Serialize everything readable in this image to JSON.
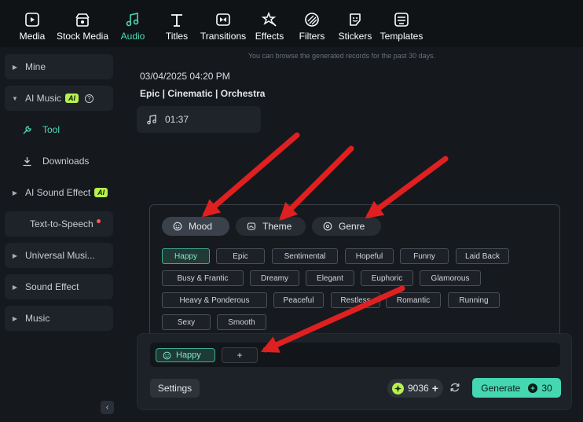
{
  "toolbar": {
    "items": [
      {
        "label": "Media",
        "icon": "media-icon"
      },
      {
        "label": "Stock Media",
        "icon": "stock-media-icon"
      },
      {
        "label": "Audio",
        "icon": "audio-icon",
        "active": true
      },
      {
        "label": "Titles",
        "icon": "titles-icon"
      },
      {
        "label": "Transitions",
        "icon": "transitions-icon"
      },
      {
        "label": "Effects",
        "icon": "effects-icon"
      },
      {
        "label": "Filters",
        "icon": "filters-icon"
      },
      {
        "label": "Stickers",
        "icon": "stickers-icon"
      },
      {
        "label": "Templates",
        "icon": "templates-icon"
      }
    ]
  },
  "sidebar": {
    "mine": "Mine",
    "ai_music": "AI Music",
    "ai_badge": "AI",
    "tool": "Tool",
    "downloads": "Downloads",
    "ai_sound_effect": "AI Sound Effect",
    "text_to_speech": "Text-to-Speech",
    "universal_music": "Universal Musi...",
    "sound_effect": "Sound Effect",
    "music": "Music",
    "collapse_glyph": "‹"
  },
  "main": {
    "note": "You can browse the generated records for the past 30 days.",
    "record": {
      "date": "03/04/2025 04:20 PM",
      "tags": "Epic | Cinematic | Orchestra",
      "duration": "01:37"
    },
    "categories": {
      "mood": "Mood",
      "theme": "Theme",
      "genre": "Genre"
    },
    "chips": {
      "happy": "Happy",
      "epic": "Epic",
      "sentimental": "Sentimental",
      "hopeful": "Hopeful",
      "funny": "Funny",
      "laid_back": "Laid Back",
      "busy_frantic": "Busy & Frantic",
      "dreamy": "Dreamy",
      "elegant": "Elegant",
      "euphoric": "Euphoric",
      "glamorous": "Glamorous",
      "heavy_ponderous": "Heavy & Ponderous",
      "peaceful": "Peaceful",
      "restless": "Restless",
      "romantic": "Romantic",
      "running": "Running",
      "sexy": "Sexy",
      "smooth": "Smooth"
    },
    "input": {
      "selected_tag": "Happy",
      "add_glyph": "+"
    },
    "settings": "Settings",
    "credits": "9036",
    "credits_plus": "+",
    "generate": "Generate",
    "generate_cost": "30"
  },
  "colors": {
    "accent": "#45d7b2",
    "ai_badge": "#b7f24b",
    "annotation_arrow": "#e02020"
  }
}
